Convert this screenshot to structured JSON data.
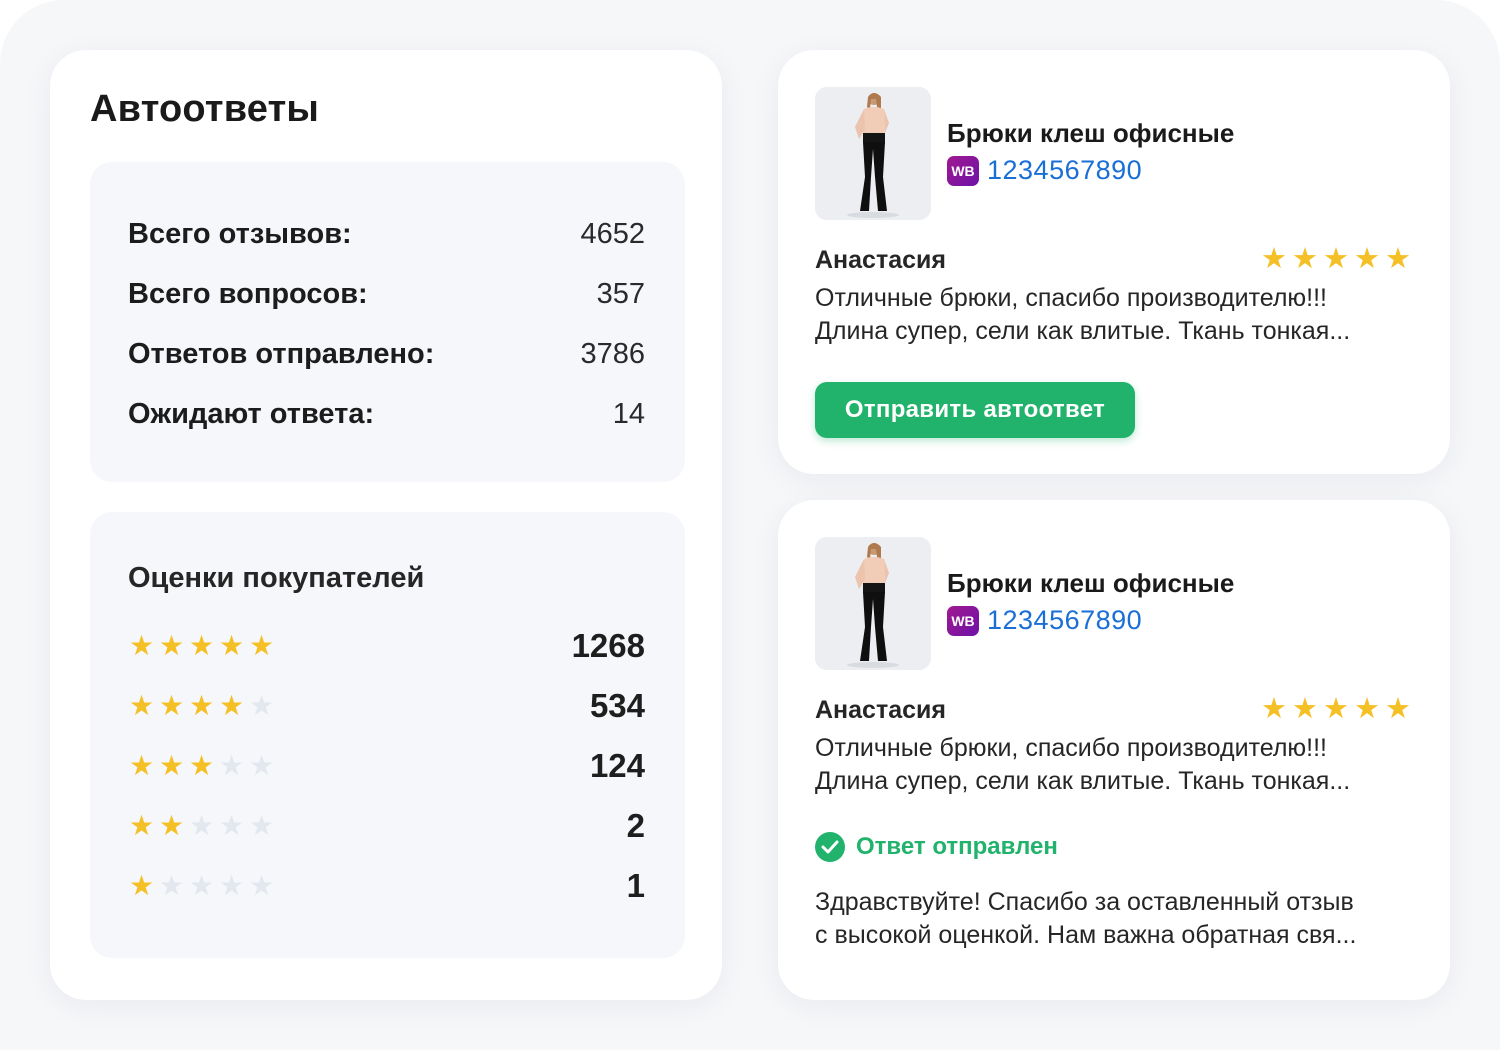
{
  "left": {
    "title": "Автоответы",
    "stats": [
      {
        "label": "Всего отзывов:",
        "value": "4652"
      },
      {
        "label": "Всего вопросов:",
        "value": "357"
      },
      {
        "label": "Ответов отправлено:",
        "value": "3786"
      },
      {
        "label": "Ожидают ответа:",
        "value": "14"
      }
    ],
    "ratings_title": "Оценки покупателей",
    "ratings": [
      {
        "stars": 5,
        "count": "1268"
      },
      {
        "stars": 4,
        "count": "534"
      },
      {
        "stars": 3,
        "count": "124"
      },
      {
        "stars": 2,
        "count": "2"
      },
      {
        "stars": 1,
        "count": "1"
      }
    ]
  },
  "reviews": [
    {
      "product_name": "Брюки клеш офисные",
      "badge": "WB",
      "sku": "1234567890",
      "reviewer": "Анастасия",
      "rating": 5,
      "text_line1": "Отличные брюки, спасибо производителю!!!",
      "text_line2": "Длина супер, сели как влитые. Ткань тонкая...",
      "action_label": "Отправить автоответ"
    },
    {
      "product_name": "Брюки клеш офисные",
      "badge": "WB",
      "sku": "1234567890",
      "reviewer": "Анастасия",
      "rating": 5,
      "text_line1": "Отличные брюки, спасибо производителю!!!",
      "text_line2": "Длина супер, сели как влитые. Ткань тонкая...",
      "status_label": "Ответ отправлен",
      "reply_line1": "Здравствуйте! Спасибо за оставленный отзыв",
      "reply_line2": "с высокой оценкой. Нам важна обратная свя..."
    }
  ],
  "colors": {
    "accent_green": "#21b36c",
    "star": "#f5c026",
    "star_empty": "#e3e7ee",
    "sku_link": "#1a6fd6",
    "wb_badge": "#8a169c"
  },
  "icons": {
    "star": "star-icon",
    "check": "check-circle-icon",
    "marketplace": "wb-badge-icon",
    "product": "product-photo"
  }
}
